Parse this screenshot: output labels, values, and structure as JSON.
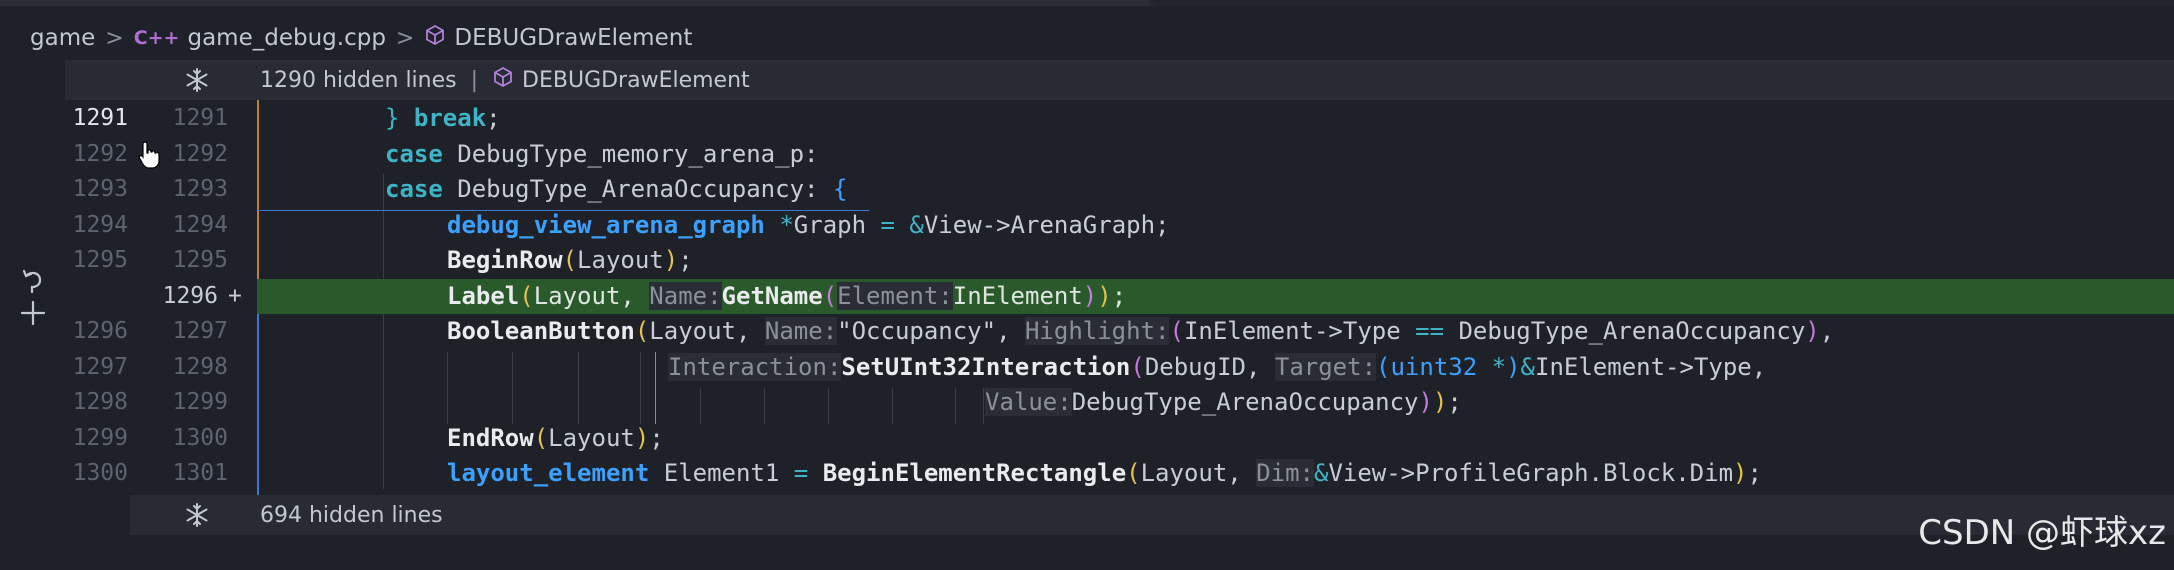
{
  "breadcrumb": {
    "items": [
      "game",
      "game_debug.cpp",
      "DEBUGDrawElement"
    ],
    "cpp_glyph": "C++",
    "separator": ">"
  },
  "fold_top": {
    "hidden": "1290 hidden lines",
    "pipe": "|",
    "symbol": "DEBUGDrawElement"
  },
  "fold_bottom": {
    "hidden": "694 hidden lines"
  },
  "rows": [
    {
      "l": "1291",
      "r": "1291"
    },
    {
      "l": "1292",
      "r": "1292"
    },
    {
      "l": "1293",
      "r": "1293"
    },
    {
      "l": "1294",
      "r": "1294"
    },
    {
      "l": "1295",
      "r": "1295"
    },
    {
      "l": "",
      "r": "1296",
      "plus": "+"
    },
    {
      "l": "1296",
      "r": "1297"
    },
    {
      "l": "1297",
      "r": "1298"
    },
    {
      "l": "1298",
      "r": "1299"
    },
    {
      "l": "1299",
      "r": "1300"
    },
    {
      "l": "1300",
      "r": "1301"
    }
  ],
  "code": {
    "r0": [
      "}",
      " ",
      "break",
      ";"
    ],
    "r1": [
      "case",
      " DebugType_memory_arena_p:"
    ],
    "r2": [
      "case",
      " DebugType_ArenaOccupancy: ",
      "{"
    ],
    "r3": [
      "debug_view_arena_graph",
      " ",
      "*",
      "Graph ",
      "=",
      " ",
      "&",
      "View->ArenaGraph;"
    ],
    "r4": [
      "BeginRow",
      "(",
      "Layout",
      ")",
      ";"
    ],
    "r5": [
      "Label",
      "(",
      "Layout, ",
      "Name:",
      "GetName",
      "(",
      "Element:",
      "InElement",
      ")",
      ")",
      ";"
    ],
    "r6": [
      "BooleanButton",
      "(",
      "Layout, ",
      "Name:",
      "\"Occupancy\", ",
      "Highlight:",
      "(",
      "InElement->Type ",
      "==",
      " DebugType_ArenaOccupancy",
      ")",
      ","
    ],
    "r7": [
      "Interaction:",
      "SetUInt32Interaction",
      "(",
      "DebugID, ",
      "Target:",
      "(",
      "uint32 ",
      "*",
      ")",
      "&",
      "InElement->Type,"
    ],
    "r8": [
      "Value:",
      "DebugType_ArenaOccupancy",
      ")",
      ")",
      ";"
    ],
    "r9": [
      "EndRow",
      "(",
      "Layout",
      ")",
      ";"
    ],
    "r10": [
      "layout_element",
      " Element1 ",
      "=",
      " ",
      "BeginElementRectangle",
      "(",
      "Layout, ",
      "Dim:",
      "&",
      "View->ProfileGraph.Block.Dim",
      ")",
      ";"
    ]
  },
  "watermark": "CSDN @虾球xz",
  "icons": {
    "breadcrumb_chevron": "chevron-right-icon",
    "cpp_file": "cpp-file-icon",
    "symbol": "cube-icon",
    "unfold": "snowflake-fold-icon",
    "cursor": "hand-cursor-icon",
    "revert": "revert-icon"
  },
  "colors": {
    "added_line_bg": "#2a5a2c",
    "keyword": "#3fb4c6",
    "type": "#3ca0ff",
    "bracket": "#e5c24b"
  }
}
